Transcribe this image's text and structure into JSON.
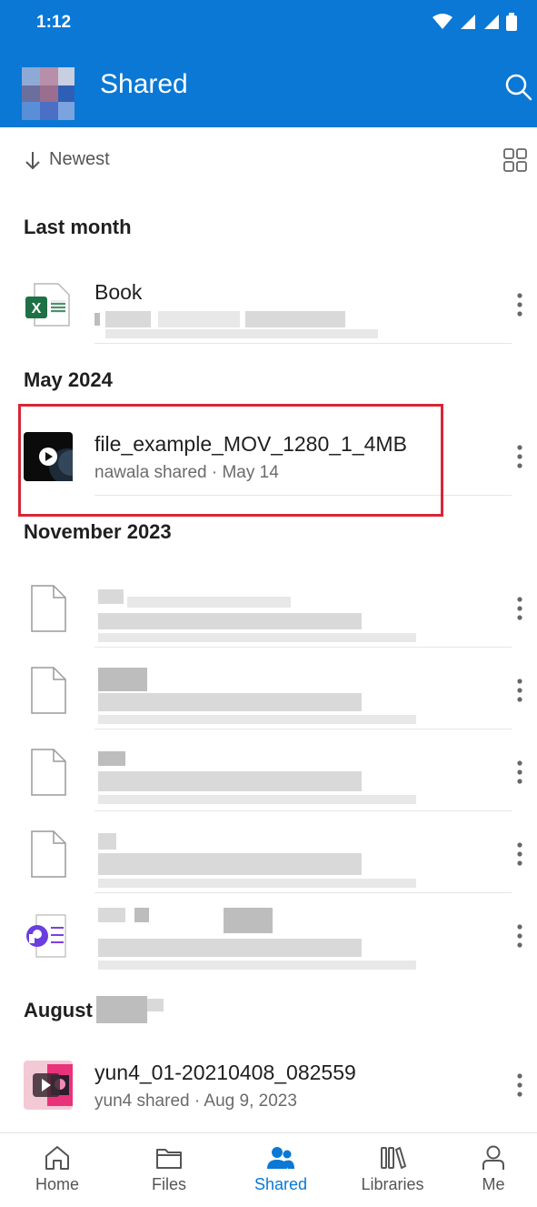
{
  "status": {
    "time": "1:12"
  },
  "header": {
    "title": "Shared"
  },
  "sort": {
    "label": "Newest"
  },
  "sections": {
    "last_month": "Last month",
    "may_2024": "May 2024",
    "nov_2023": "November 2023",
    "august": "August"
  },
  "files": {
    "book": {
      "name": "Book",
      "icon": "excel-icon"
    },
    "video": {
      "name": "file_example_MOV_1280_1_4MB",
      "meta": "nawala shared · May 14",
      "icon": "video-thumbnail"
    },
    "yun4": {
      "name": "yun4_01-20210408_082559",
      "meta": "yun4 shared · Aug 9, 2023",
      "icon": "video-thumbnail-pink"
    }
  },
  "nav": {
    "home": "Home",
    "files": "Files",
    "shared": "Shared",
    "libraries": "Libraries",
    "me": "Me"
  },
  "colors": {
    "brand": "#0a78d4",
    "highlight": "#d72635"
  }
}
